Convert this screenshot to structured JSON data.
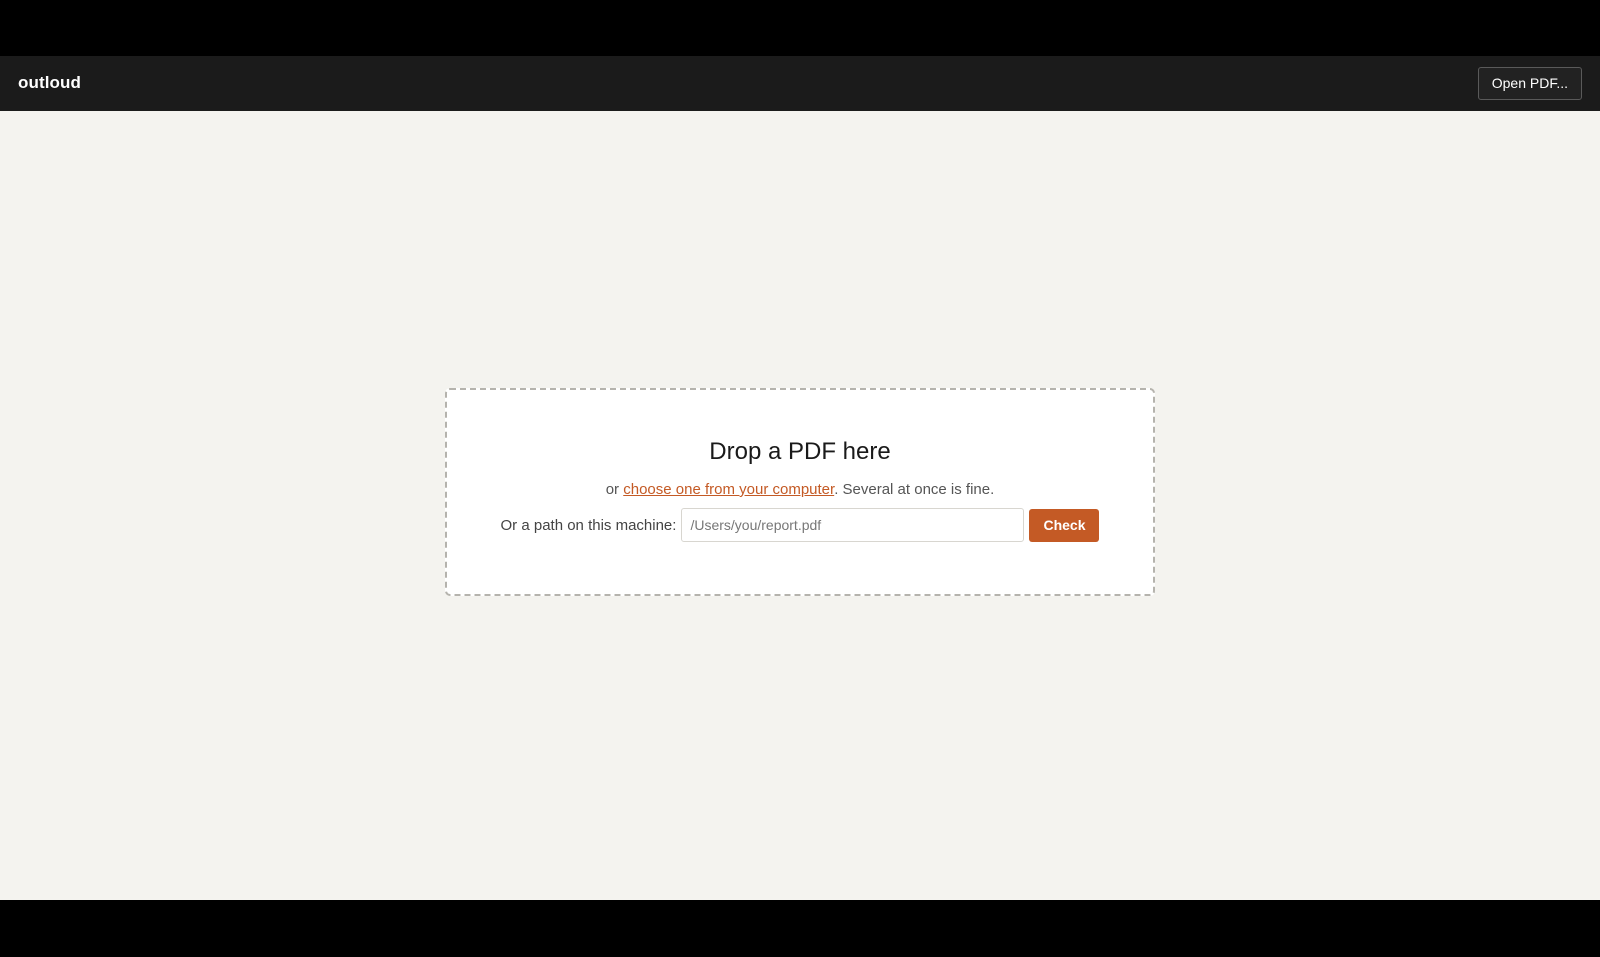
{
  "app": {
    "title": "outloud",
    "open_button_label": "Open PDF..."
  },
  "dropzone": {
    "title": "Drop a PDF here",
    "sub_prefix": "or ",
    "choose_link": "choose one from your computer",
    "sub_suffix": ". Several at once is fine.",
    "path_label": "Or a path on this machine:",
    "path_placeholder": "/Users/you/report.pdf",
    "path_value": "",
    "check_label": "Check"
  },
  "colors": {
    "accent": "#c45a25",
    "header_bg": "#1b1b1b",
    "page_bg": "#f4f3ef"
  }
}
